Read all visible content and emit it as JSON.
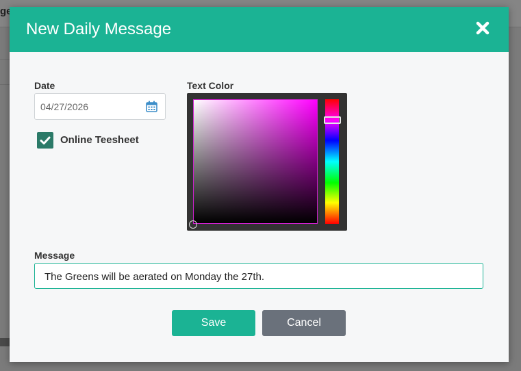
{
  "background": {
    "heading_fragment": "ge"
  },
  "modal": {
    "title": "New Daily Message",
    "close_icon": "close-icon"
  },
  "date": {
    "label": "Date",
    "value": "04/27/2026",
    "icon": "calendar-icon"
  },
  "online_teesheet": {
    "label": "Online Teesheet",
    "checked": true
  },
  "text_color": {
    "label": "Text Color",
    "selected_hue": "#ff00ff",
    "selected_color": "#000000"
  },
  "message": {
    "label": "Message",
    "value": "The Greens will be aerated on Monday the 27th."
  },
  "buttons": {
    "save": "Save",
    "cancel": "Cancel"
  },
  "colors": {
    "accent": "#1bb394",
    "checkbox": "#2b7a68",
    "cancel": "#6a717b"
  }
}
